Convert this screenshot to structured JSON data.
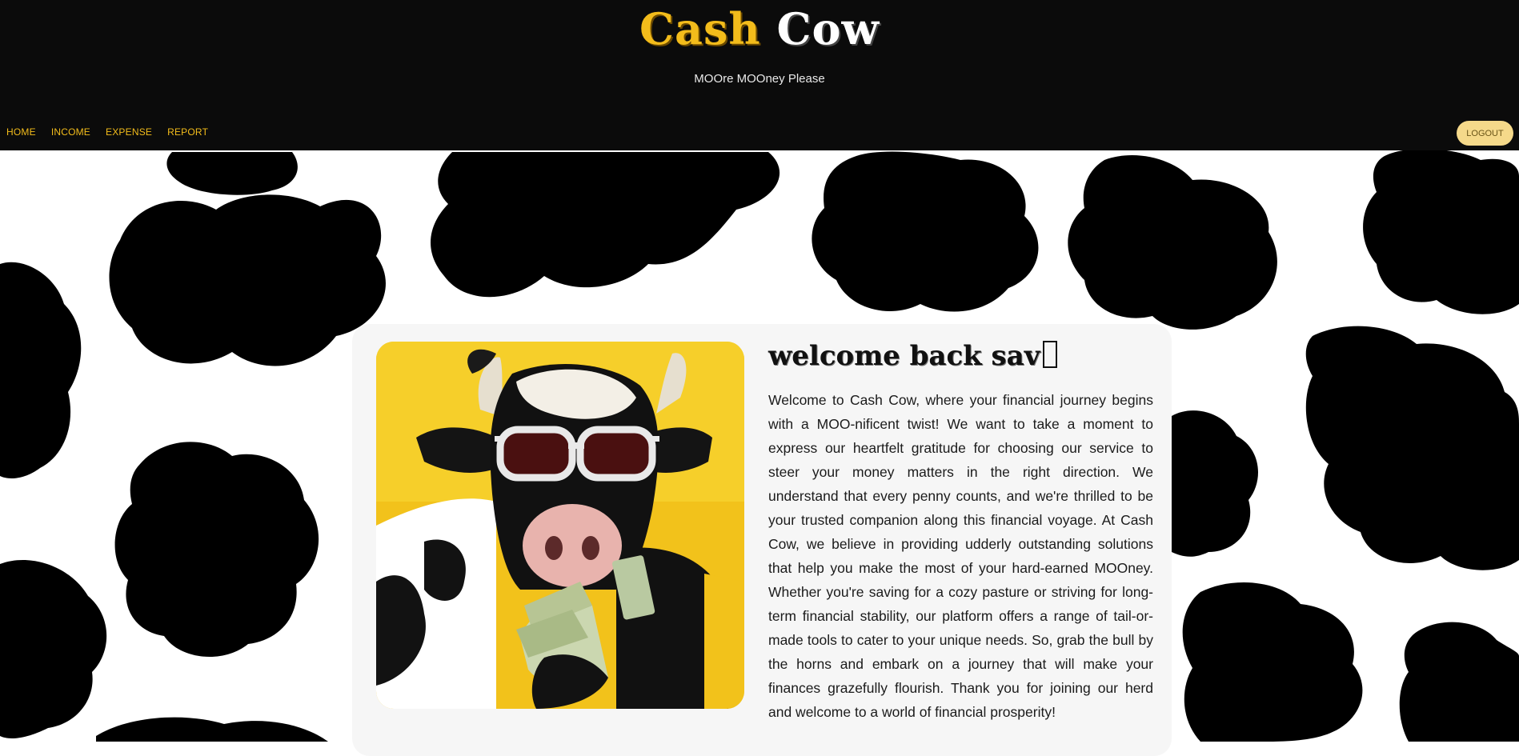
{
  "app": {
    "logo_word1": "Cash",
    "logo_word2": "Cow",
    "tagline": "MOOre MOOney Please"
  },
  "nav": {
    "items": [
      {
        "label": "HOME"
      },
      {
        "label": "INCOME"
      },
      {
        "label": "EXPENSE"
      },
      {
        "label": "REPORT"
      }
    ],
    "logout_label": "LOGOUT"
  },
  "main": {
    "welcome_title": "welcome back sav",
    "description": "Welcome to Cash Cow, where your financial journey begins with a MOO-nificent twist! We want to take a moment to express our heartfelt gratitude for choosing our service to steer your money matters in the right direction. We understand that every penny counts, and we're thrilled to be your trusted companion along this financial voyage. At Cash Cow, we believe in providing udderly outstanding solutions that help you make the most of your hard-earned MOOney. Whether you're saving for a cozy pasture or striving for long-term financial stability, our platform offers a range of tail-or-made tools to cater to your unique needs. So, grab the bull by the horns and embark on a journey that will make your finances grazefully flourish. Thank you for joining our herd and welcome to a world of financial prosperity!"
  },
  "colors": {
    "header_bg": "#0b0b0b",
    "accent_yellow": "#f3bc1b",
    "logout_bg": "#f5d98a",
    "card_bg": "#f6f6f6"
  }
}
